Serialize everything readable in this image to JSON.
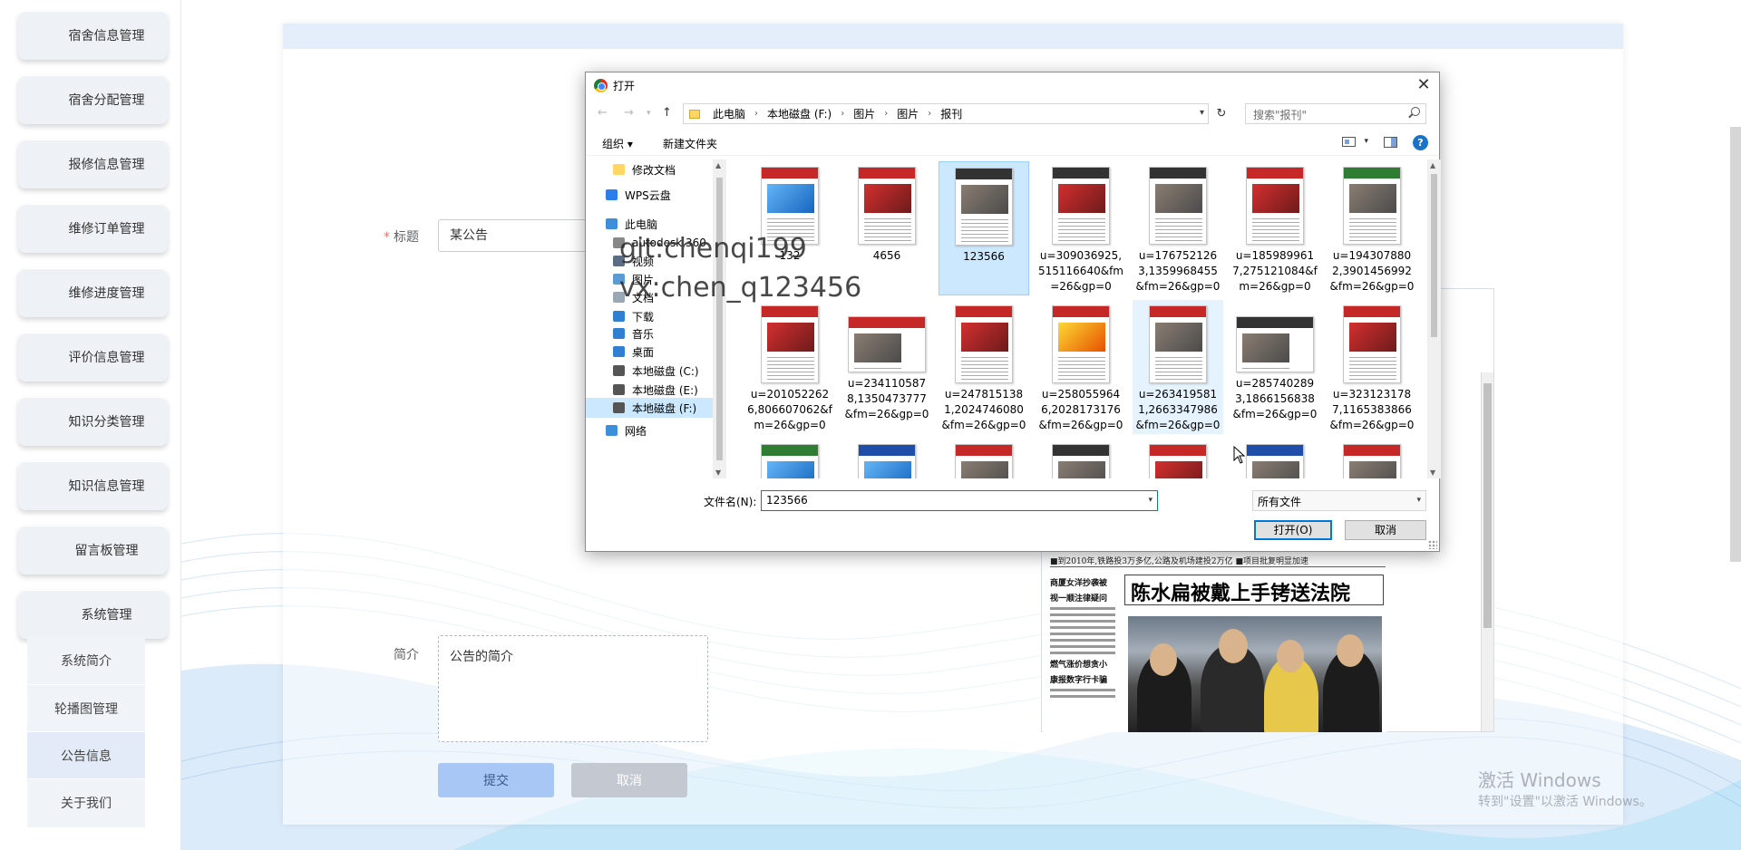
{
  "sidebar": {
    "items": [
      {
        "label": "宿舍信息管理"
      },
      {
        "label": "宿舍分配管理"
      },
      {
        "label": "报修信息管理"
      },
      {
        "label": "维修订单管理"
      },
      {
        "label": "维修进度管理"
      },
      {
        "label": "评价信息管理"
      },
      {
        "label": "知识分类管理"
      },
      {
        "label": "知识信息管理"
      },
      {
        "label": "留言板管理"
      },
      {
        "label": "系统管理"
      }
    ],
    "sub_items": [
      {
        "label": "系统简介"
      },
      {
        "label": "轮播图管理"
      },
      {
        "label": "公告信息"
      },
      {
        "label": "关于我们"
      }
    ]
  },
  "form": {
    "title_label": "标题",
    "title_required": "*",
    "title_value": "某公告",
    "intro_label": "简介",
    "intro_value": "公告的简介",
    "submit_label": "提交",
    "cancel_label": "取消"
  },
  "newspaper_preview": {
    "top_line": "■到2010年,铁路投3万多亿,公路及机场建投2万亿  ■项目批复明显加速",
    "headline": "陈水扁被戴上手铐送法院",
    "left_head1": "商厦女洋抄袭被",
    "left_head2": "视一顺注律疑问",
    "left_head3": "燃气涨价想贪小",
    "left_head4": "康报数字行卡骗"
  },
  "dialog": {
    "title": "打开",
    "close_glyph": "✕",
    "address": [
      "此电脑",
      "本地磁盘 (F:)",
      "图片",
      "图片",
      "报刊"
    ],
    "search_placeholder": "搜索\"报刊\"",
    "toolbar": {
      "organize": "组织 ▾",
      "new_folder": "新建文件夹",
      "help": "?"
    },
    "nav_items": [
      {
        "label": "修改文档",
        "icon": "folder-icon",
        "color": "#ffd664"
      },
      {
        "label": "WPS云盘",
        "icon": "cloud-icon",
        "color": "#2b7de9"
      },
      {
        "label": "此电脑",
        "icon": "computer-icon",
        "color": "#3d8fd9"
      },
      {
        "label": "autodesk 360",
        "icon": "cloud-icon",
        "color": "#888888"
      },
      {
        "label": "视频",
        "icon": "video-icon",
        "color": "#5a6d82"
      },
      {
        "label": "图片",
        "icon": "picture-icon",
        "color": "#5a9bd5"
      },
      {
        "label": "文档",
        "icon": "document-icon",
        "color": "#9aa7b5"
      },
      {
        "label": "下载",
        "icon": "download-icon",
        "color": "#2f7fd3"
      },
      {
        "label": "音乐",
        "icon": "music-icon",
        "color": "#2f7fd3"
      },
      {
        "label": "桌面",
        "icon": "desktop-icon",
        "color": "#2f7fd3"
      },
      {
        "label": "本地磁盘 (C:)",
        "icon": "drive-icon",
        "color": "#555555"
      },
      {
        "label": "本地磁盘 (E:)",
        "icon": "drive-icon",
        "color": "#555555"
      },
      {
        "label": "本地磁盘 (F:)",
        "icon": "drive-icon",
        "color": "#555555"
      },
      {
        "label": "网络",
        "icon": "network-icon",
        "color": "#3d8fd9"
      }
    ],
    "files": [
      {
        "name": "132",
        "mast": "",
        "img": "blue"
      },
      {
        "name": "4656",
        "mast": "",
        "img": "red"
      },
      {
        "name": "123566",
        "mast": "dark",
        "img": "",
        "selected": true
      },
      {
        "name": "u=309036925,515116640&fm=26&gp=0",
        "mast": "dark",
        "img": "red"
      },
      {
        "name": "u=1767521263,1359968455&fm=26&gp=0",
        "mast": "dark",
        "img": ""
      },
      {
        "name": "u=1859899617,275121084&fm=26&gp=0",
        "mast": "",
        "img": "red"
      },
      {
        "name": "u=1943078802,3901456992&fm=26&gp=0",
        "mast": "green",
        "img": ""
      },
      {
        "name": "u=2010522626,806607062&fm=26&gp=0",
        "mast": "",
        "img": "red"
      },
      {
        "name": "u=2341105878,1350473777&fm=26&gp=0",
        "mast": "",
        "img": "",
        "wide": true
      },
      {
        "name": "u=2478151381,2024746080&fm=26&gp=0",
        "mast": "",
        "img": "red"
      },
      {
        "name": "u=2580559646,2028173176&fm=26&gp=0",
        "mast": "",
        "img": "yel"
      },
      {
        "name": "u=2634195811,2663347986&fm=26&gp=0",
        "mast": "",
        "img": "",
        "hover": true
      },
      {
        "name": "u=2857402893,1866156838&fm=26&gp=0",
        "mast": "dark",
        "img": "",
        "wide": true
      },
      {
        "name": "u=3231231787,1165383866&fm=26&gp=0",
        "mast": "",
        "img": "red"
      },
      {
        "name": "",
        "mast": "green",
        "img": "blue"
      },
      {
        "name": "",
        "mast": "blue",
        "img": "blue"
      },
      {
        "name": "",
        "mast": "",
        "img": ""
      },
      {
        "name": "",
        "mast": "dark",
        "img": ""
      },
      {
        "name": "",
        "mast": "",
        "img": "red"
      },
      {
        "name": "",
        "mast": "blue",
        "img": ""
      },
      {
        "name": "",
        "mast": "",
        "img": ""
      }
    ],
    "filename_label": "文件名(N):",
    "filename_value": "123566",
    "filetype_value": "所有文件",
    "open_label": "打开(O)",
    "cancel_label": "取消"
  },
  "watermark": {
    "line1": "git:chenqi199",
    "line2": "vx:chen_q123456"
  },
  "windows_activation": {
    "line1": "激活 Windows",
    "line2": "转到\"设置\"以激活 Windows。"
  }
}
